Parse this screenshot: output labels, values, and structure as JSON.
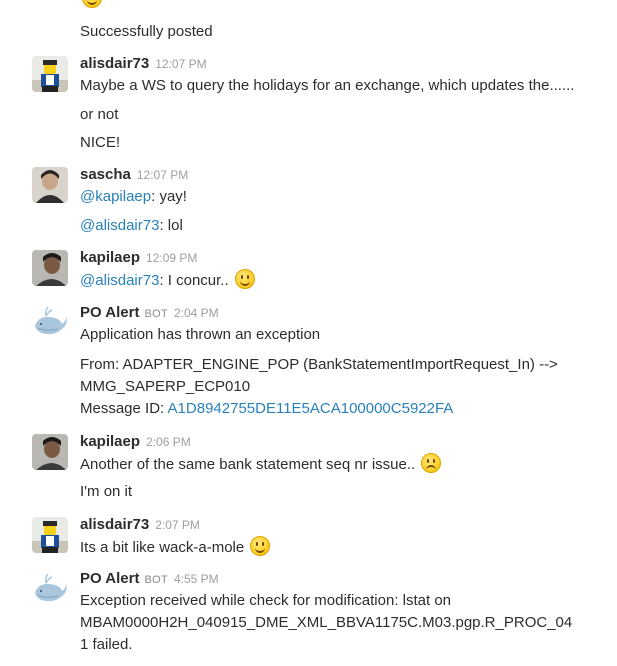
{
  "messages": {
    "m0": {
      "text": "Successfully posted"
    },
    "m1": {
      "user": "alisdair73",
      "time": "12:07 PM",
      "lines": [
        "Maybe a WS to query the holidays for an exchange, which updates the......",
        "or not",
        "NICE!"
      ]
    },
    "m2": {
      "user": "sascha",
      "time": "12:07 PM",
      "l1_mention": "@kapilaep",
      "l1_text": ": yay!",
      "l2_mention": "@alisdair73",
      "l2_text": ": lol"
    },
    "m3": {
      "user": "kapilaep",
      "time": "12:09 PM",
      "l1_mention": "@alisdair73",
      "l1_text": ": I concur.."
    },
    "m4": {
      "user": "PO Alert",
      "bot": "BOT",
      "time": "2:04 PM",
      "line1": "Application has thrown an exception",
      "line2": "From: ADAPTER_ENGINE_POP (BankStatementImportRequest_In) -->",
      "line3": "MMG_SAPERP_ECP010",
      "line4_label": "Message ID: ",
      "line4_link": "A1D8942755DE11E5ACA100000C5922FA"
    },
    "m5": {
      "user": "kapilaep",
      "time": "2:06 PM",
      "line1": "Another of the same bank statement seq nr issue..",
      "line2": "I'm on it"
    },
    "m6": {
      "user": "alisdair73",
      "time": "2:07 PM",
      "line1": "Its a bit like wack-a-mole"
    },
    "m7": {
      "user": "PO Alert",
      "bot": "BOT",
      "time": "4:55 PM",
      "line1": "Exception received while check for modification: lstat on",
      "line2": "MBAM0000H2H_040915_DME_XML_BBVA1175C.M03.pgp.R_PROC_04",
      "line3": "1 failed."
    }
  },
  "icons": {
    "lego_avatar": "lego-figure-avatar",
    "sascha_avatar": "person-avatar",
    "kapilaep_avatar": "person-avatar",
    "bot_avatar": "whale-avatar",
    "smile": "slightly-smiling-face-icon",
    "sad": "disappointed-face-icon"
  },
  "colors": {
    "mention": "#2a80b9",
    "timestamp": "#9e9ea6",
    "text": "#2c2d30"
  }
}
